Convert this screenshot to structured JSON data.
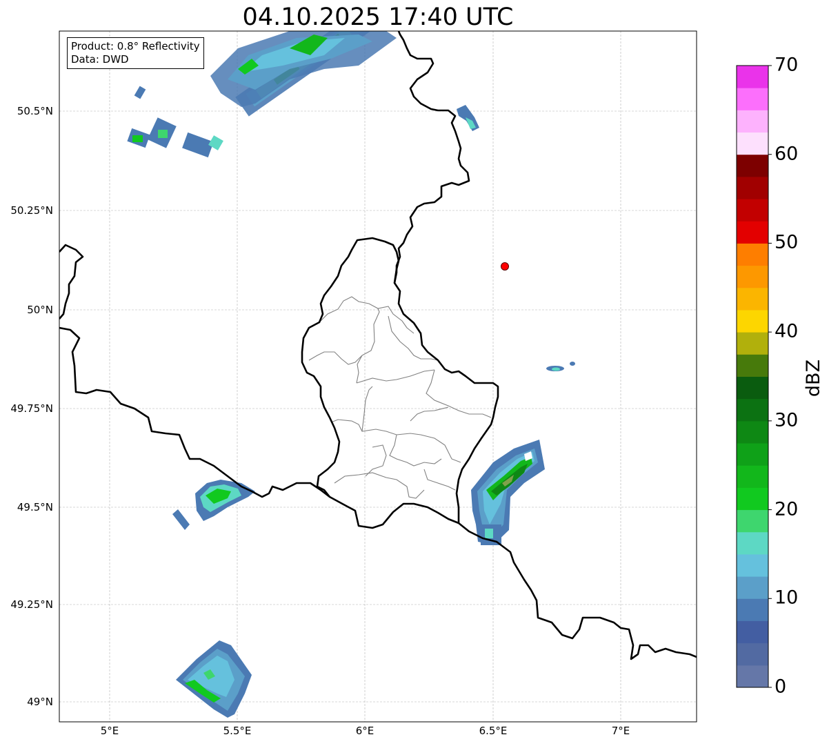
{
  "title": "04.10.2025 17:40 UTC",
  "info": {
    "product": "Product: 0.8° Reflectivity",
    "source": "Data: DWD"
  },
  "axes": {
    "lat_ticks": [
      "50.5°N",
      "50.25°N",
      "50°N",
      "49.75°N",
      "49.5°N",
      "49.25°N",
      "49°N"
    ],
    "lon_ticks": [
      "5°E",
      "5.5°E",
      "6°E",
      "6.5°E",
      "7°E"
    ],
    "lat_values": [
      50.5,
      50.25,
      50.0,
      49.75,
      49.5,
      49.25,
      49.0
    ],
    "lon_values": [
      5.0,
      5.5,
      6.0,
      6.5,
      7.0
    ],
    "lon_range": [
      4.8,
      7.3
    ],
    "lat_range": [
      48.95,
      50.7
    ],
    "grid": true
  },
  "colorbar": {
    "label": "dBZ",
    "ticks": [
      "0",
      "10",
      "20",
      "30",
      "40",
      "50",
      "60",
      "70"
    ],
    "range": [
      0,
      70
    ],
    "step": 2.5,
    "colors": [
      "#6577a8",
      "#526aa2",
      "#435ea2",
      "#4b7ab3",
      "#5b9fc9",
      "#65c1dd",
      "#5dd8c4",
      "#3ed66e",
      "#11c91f",
      "#12b71b",
      "#0fa118",
      "#0e8814",
      "#0c7212",
      "#0a5c0f",
      "#477a0b",
      "#b1b00c",
      "#fdd600",
      "#fbb500",
      "#fd9800",
      "#fe7e00",
      "#e30000",
      "#c20000",
      "#a10000",
      "#7d0000",
      "#fde0fd",
      "#fdb2fd",
      "#fc6ffc",
      "#ea33ea"
    ]
  },
  "site_marker": {
    "lon": 6.55,
    "lat": 50.11,
    "color": "#ff0000"
  },
  "map_features": [
    "country-borders",
    "luxembourg-canton-borders",
    "radar-echoes"
  ]
}
